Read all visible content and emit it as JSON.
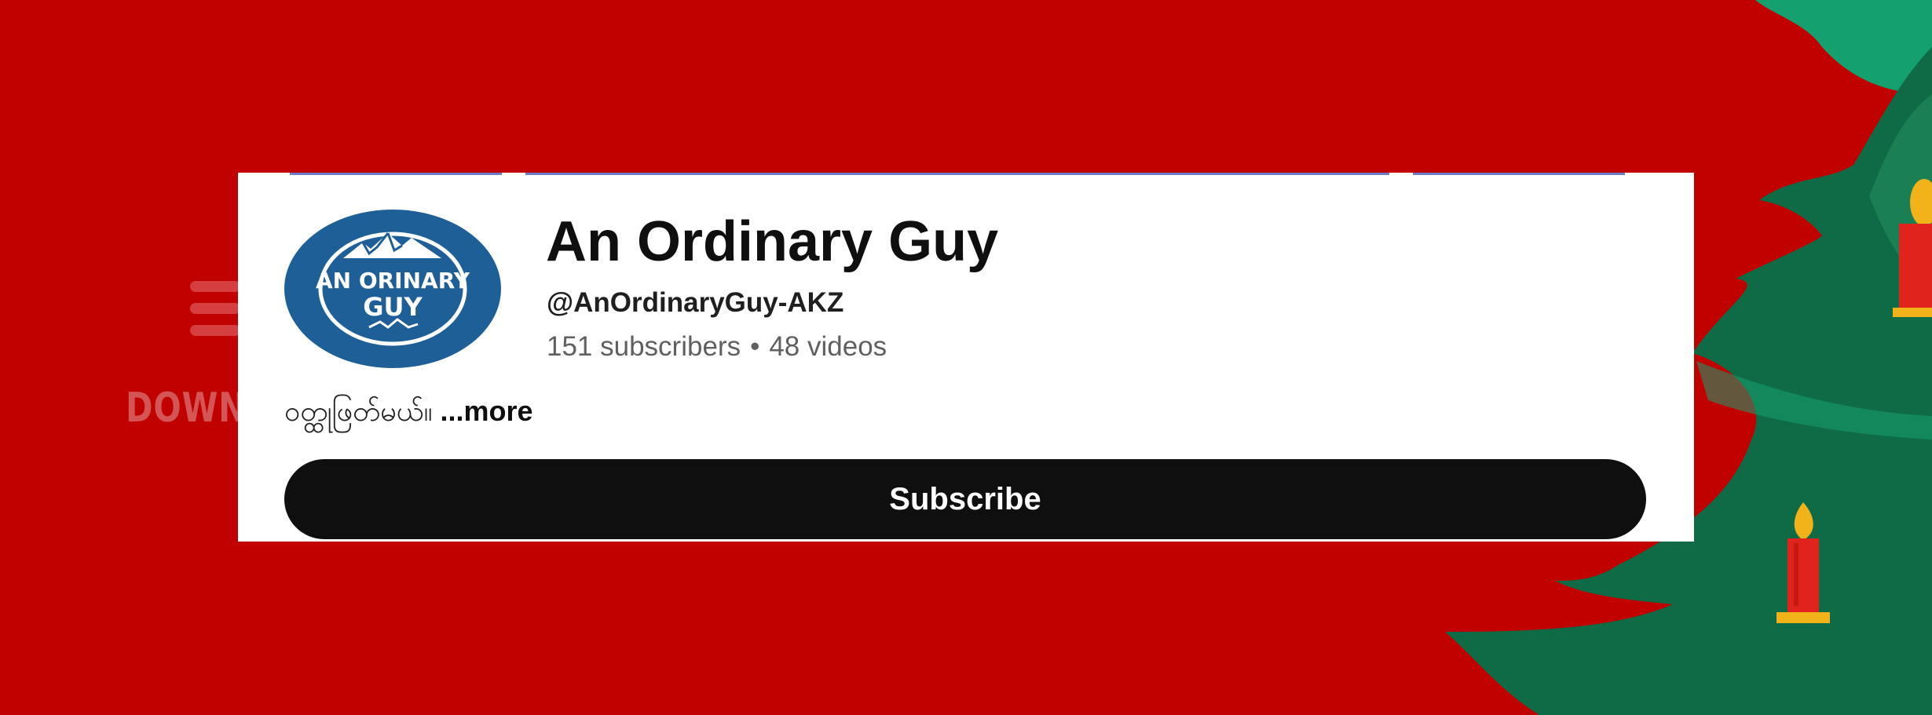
{
  "colors": {
    "background": "#c10000",
    "card": "#ffffff",
    "subscribe_button": "#0f0f0f",
    "avatar": "#1f5f98",
    "tree_dark": "#0e6b45",
    "tree_light": "#15a06f",
    "candle": "#e0231c",
    "flame": "#f2b21a"
  },
  "background": {
    "text": "DOWNT",
    "icons": [
      "hamburger-icon",
      "christmas-tree",
      "candle-icon"
    ]
  },
  "channel": {
    "avatar_text_line1": "AN ORINARY",
    "avatar_text_line2": "GUY",
    "name": "An Ordinary Guy",
    "handle": "@AnOrdinaryGuy-AKZ",
    "subscribers": "151 subscribers",
    "separator": "•",
    "videos": "48 videos",
    "description": "ဝတ္ထုဖြတ်မယ်။ ",
    "more_label": "...more",
    "subscribe_label": "Subscribe"
  }
}
